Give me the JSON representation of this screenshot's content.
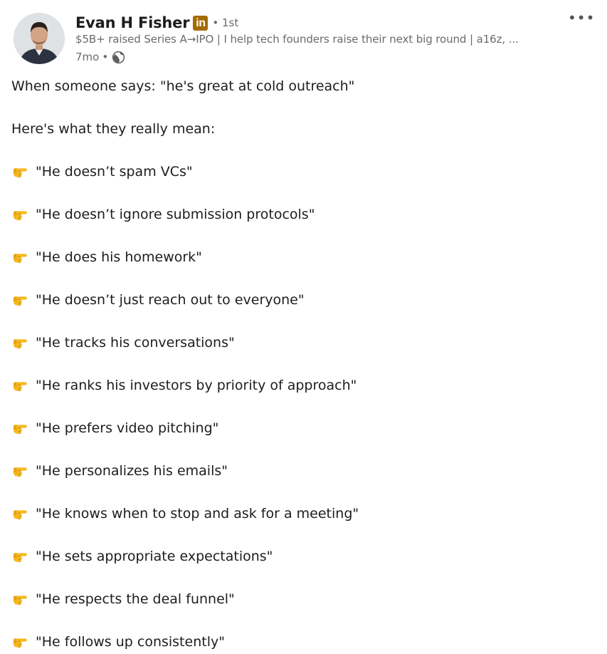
{
  "author": {
    "name": "Evan H Fisher",
    "badge": "in",
    "degree": "• 1st",
    "headline": "$5B+ raised Series A→IPO | I help tech founders raise their next big round | a16z, ...",
    "time": "7mo",
    "separator": "•",
    "visibility_icon": "globe-icon",
    "avatar_icon": "profile-photo"
  },
  "menu": {
    "more_label": "•••",
    "more_icon": "more-horizontal-icon"
  },
  "post": {
    "intro": "When someone says: \"he's great at cold outreach\"",
    "lead": "Here's what they really mean:",
    "bullet_icon": "backhand-index-pointing-right-icon",
    "items": [
      "\"He doesn’t spam VCs\"",
      "\"He doesn’t ignore submission protocols\"",
      "\"He does his homework\"",
      "\"He doesn’t just reach out to everyone\"",
      "\"He tracks his conversations\"",
      "\"He ranks his investors by priority of approach\"",
      "\"He prefers video pitching\"",
      "\"He personalizes his emails\"",
      "\"He knows when to stop and ask for a meeting\"",
      "\"He sets appropriate expectations\"",
      "\"He respects the deal funnel\"",
      "\"He follows up consistently\""
    ]
  },
  "colors": {
    "text": "#1d1d1d",
    "secondary_text": "#6b6b6b",
    "badge": "#a46b00",
    "pointing_hand": "#f5b91e"
  }
}
